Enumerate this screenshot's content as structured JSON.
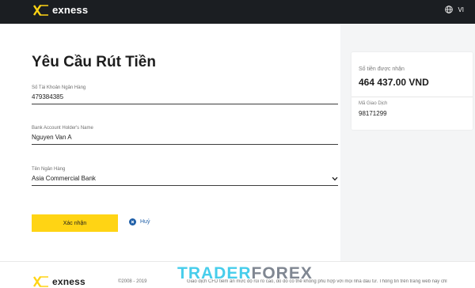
{
  "header": {
    "brand": "exness",
    "language": "VI"
  },
  "form": {
    "title": "Yêu Cầu Rút Tiền",
    "fields": [
      {
        "label": "Số Tài Khoản Ngân Hàng",
        "value": "479384385"
      },
      {
        "label": "Bank Account Holder's Name",
        "value": "Nguyen Van A"
      },
      {
        "label": "Tên Ngân Hàng",
        "value": "Asia Commercial Bank"
      }
    ],
    "confirm_label": "Xác nhận",
    "cancel_label": "Huỷ"
  },
  "summary": {
    "amount_label": "Số tiền được nhận",
    "amount": "464 437.00 VND",
    "code_label": "Mã Giao Dịch",
    "code": "98171299"
  },
  "footer": {
    "brand": "exness",
    "copyright": "©2008 - 2019",
    "disclaimer": "Giao dịch CFD tiềm ẩn mức độ rủi ro cao, do đó có thể không phù hợp với mọi nhà đầu tư. Thông tin trên trang web này chỉ"
  },
  "watermark": {
    "part1": "TRADER",
    "part2": "FOREX"
  },
  "colors": {
    "header_bg": "#1b1e22",
    "accent_yellow": "#ffd414",
    "link_blue": "#1f5fa8",
    "watermark_cyan": "#27c5e8"
  }
}
